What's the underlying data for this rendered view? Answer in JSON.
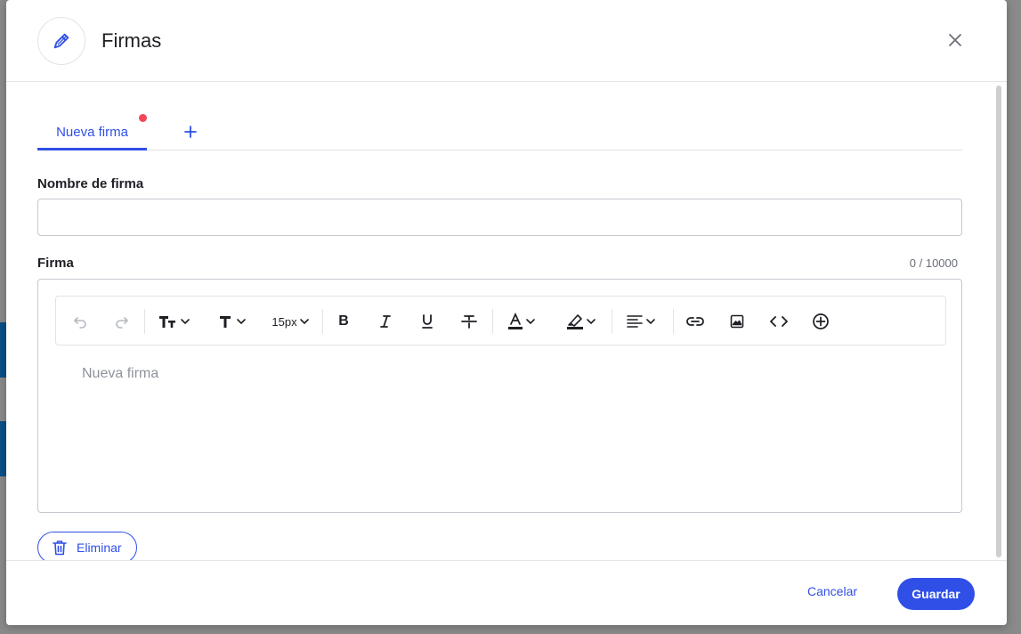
{
  "dialog": {
    "title": "Firmas",
    "header_icon": "pen-icon",
    "close_icon": "close-icon"
  },
  "tabs": [
    {
      "label": "Nueva firma",
      "active": true,
      "unsaved_indicator": true
    }
  ],
  "add_tab_icon": "plus-icon",
  "form": {
    "name_label": "Nombre de firma",
    "name_value": "",
    "signature_label": "Firma",
    "counter": "0 / 10000"
  },
  "toolbar": {
    "font_size_value": "15px",
    "buttons": [
      "undo-icon",
      "redo-icon",
      "text-size-icon",
      "font-family-icon",
      "bold-icon",
      "italic-icon",
      "underline-icon",
      "strikethrough-icon",
      "text-color-icon",
      "highlight-icon",
      "align-icon",
      "link-icon",
      "image-icon",
      "code-icon",
      "insert-icon"
    ]
  },
  "editor": {
    "placeholder": "Nueva firma"
  },
  "actions": {
    "delete_label": "Eliminar",
    "cancel_label": "Cancelar",
    "save_label": "Guardar"
  },
  "colors": {
    "accent": "#2f4fe7",
    "unsaved_dot": "#f0485a"
  }
}
